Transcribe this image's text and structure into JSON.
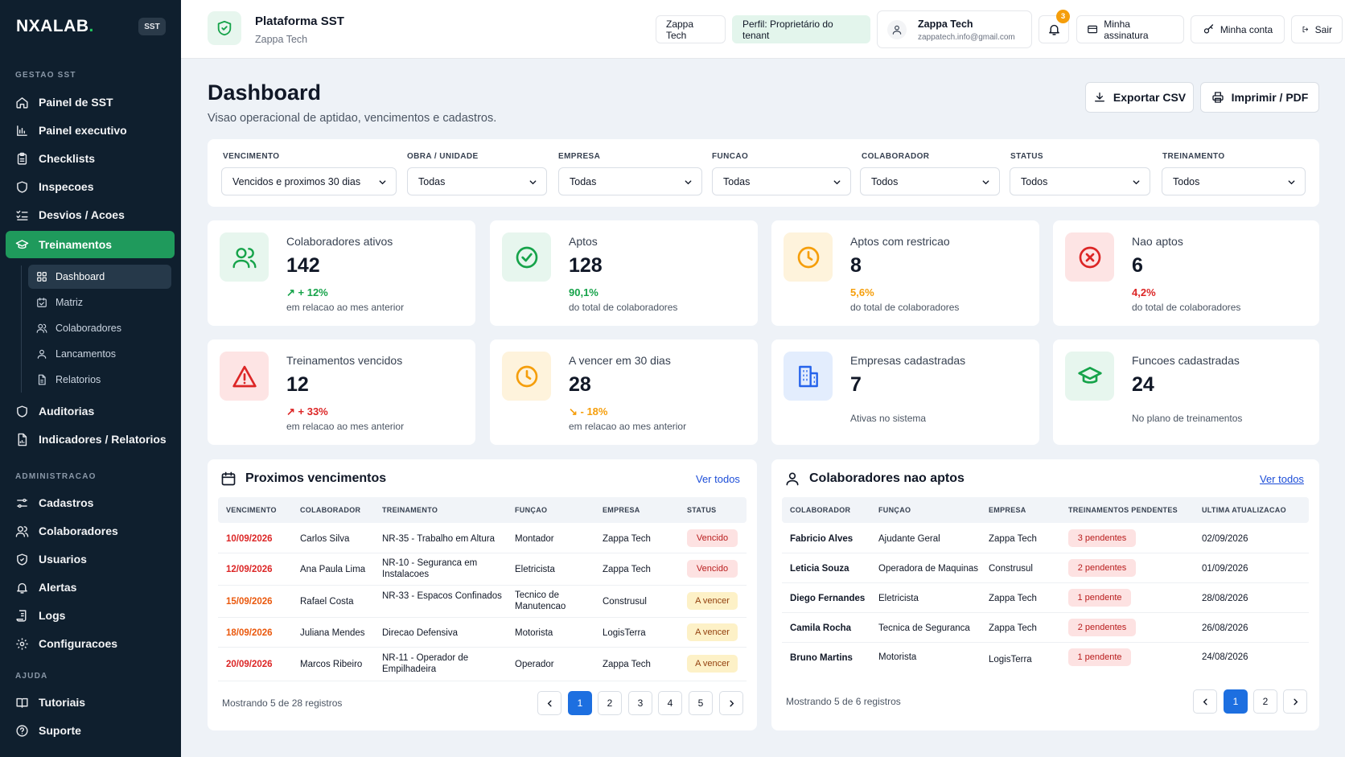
{
  "brand": {
    "name": "NXALAB",
    "dot": ".",
    "badge": "SST"
  },
  "sidebar": {
    "sections": [
      "GESTAO SST",
      "ADMINISTRACAO",
      "AJUDA"
    ],
    "gestao": [
      {
        "label": "Painel de SST",
        "icon": "home-icon"
      },
      {
        "label": "Painel executivo",
        "icon": "bar-chart-icon"
      },
      {
        "label": "Checklists",
        "icon": "clipboard-icon"
      },
      {
        "label": "Inspecoes",
        "icon": "shield-icon"
      },
      {
        "label": "Desvios / Acoes",
        "icon": "list-check-icon"
      },
      {
        "label": "Treinamentos",
        "icon": "graduation-cap-icon"
      }
    ],
    "treinamentos_sub": [
      {
        "label": "Dashboard",
        "icon": "grid-icon"
      },
      {
        "label": "Matriz",
        "icon": "calendar-check-icon"
      },
      {
        "label": "Colaboradores",
        "icon": "users-icon"
      },
      {
        "label": "Lancamentos",
        "icon": "user-icon"
      },
      {
        "label": "Relatorios",
        "icon": "file-icon"
      }
    ],
    "gestao_more": [
      {
        "label": "Auditorias",
        "icon": "shield-icon"
      },
      {
        "label": "Indicadores / Relatorios",
        "icon": "file-chart-icon"
      }
    ],
    "admin": [
      {
        "label": "Cadastros",
        "icon": "sliders-icon"
      },
      {
        "label": "Colaboradores",
        "icon": "users-icon"
      },
      {
        "label": "Usuarios",
        "icon": "shield-user-icon"
      },
      {
        "label": "Alertas",
        "icon": "bell-icon"
      },
      {
        "label": "Logs",
        "icon": "scroll-icon"
      },
      {
        "label": "Configuracoes",
        "icon": "gear-icon"
      }
    ],
    "ajuda": [
      {
        "label": "Tutoriais",
        "icon": "book-icon"
      },
      {
        "label": "Suporte",
        "icon": "help-icon"
      }
    ]
  },
  "topbar": {
    "title": "Plataforma SST",
    "subtitle": "Zappa Tech",
    "tenant_chip": "Zappa Tech",
    "profile_chip": "Perfil: Proprietário do tenant",
    "user_name": "Zappa Tech",
    "user_email": "zappatech.info@gmail.com",
    "notifications": "3",
    "subscription": "Minha assinatura",
    "account": "Minha conta",
    "logout": "Sair"
  },
  "header": {
    "title": "Dashboard",
    "subtitle": "Visao operacional de aptidao, vencimentos e cadastros.",
    "export_csv": "Exportar CSV",
    "print_pdf": "Imprimir / PDF"
  },
  "filters": [
    {
      "label": "VENCIMENTO",
      "value": "Vencidos e proximos 30 dias"
    },
    {
      "label": "OBRA / UNIDADE",
      "value": "Todas"
    },
    {
      "label": "EMPRESA",
      "value": "Todas"
    },
    {
      "label": "FUNCAO",
      "value": "Todas"
    },
    {
      "label": "COLABORADOR",
      "value": "Todos"
    },
    {
      "label": "STATUS",
      "value": "Todos"
    },
    {
      "label": "TREINAMENTO",
      "value": "Todos"
    }
  ],
  "cards": [
    {
      "title": "Colaboradores ativos",
      "value": "142",
      "trend": "+ 12%",
      "desc": "em relacao ao mes anterior",
      "icon": "users-icon",
      "color": "#16a34a"
    },
    {
      "title": "Aptos",
      "value": "128",
      "trend": "90,1%",
      "desc": "do total de colaboradores",
      "icon": "check-circle-icon",
      "color": "#16a34a"
    },
    {
      "title": "Aptos com restricao",
      "value": "8",
      "trend": "5,6%",
      "desc": "do total de colaboradores",
      "icon": "clock-icon",
      "color": "#f59e0b"
    },
    {
      "title": "Nao aptos",
      "value": "6",
      "trend": "4,2%",
      "desc": "do total de colaboradores",
      "icon": "x-circle-icon",
      "color": "#dc2626"
    },
    {
      "title": "Treinamentos vencidos",
      "value": "12",
      "trend": "+ 33%",
      "desc": "em relacao ao mes anterior",
      "icon": "warning-icon",
      "color": "#dc2626"
    },
    {
      "title": "A vencer em 30 dias",
      "value": "28",
      "trend": "- 18%",
      "desc": "em relacao ao mes anterior",
      "icon": "clock-icon",
      "color": "#f59e0b"
    },
    {
      "title": "Empresas cadastradas",
      "value": "7",
      "desc": "Ativas no sistema",
      "icon": "building-icon",
      "color": "#2563eb"
    },
    {
      "title": "Funcoes cadastradas",
      "value": "24",
      "desc": "No plano de treinamentos",
      "icon": "graduation-cap-icon",
      "color": "#16a34a"
    }
  ],
  "vencimentos": {
    "title": "Proximos vencimentos",
    "link": "Ver todos",
    "headers": [
      "VENCIMENTO",
      "COLABORADOR",
      "TREINAMENTO",
      "FUNÇAO",
      "EMPRESA",
      "STATUS"
    ],
    "rows": [
      {
        "date": "10/09/2026",
        "colaborador": "Carlos Silva",
        "treinamento": "NR-35 - Trabalho em Altura",
        "funcao": "Montador",
        "empresa": "Zappa Tech",
        "status": "Vencido"
      },
      {
        "date": "12/09/2026",
        "colaborador": "Ana Paula Lima",
        "treinamento": "NR-10 - Seguranca em Instalacoes",
        "funcao": "Eletricista",
        "empresa": "Zappa Tech",
        "status": "Vencido"
      },
      {
        "date": "15/09/2026",
        "colaborador": "Rafael Costa",
        "treinamento": "NR-33 - Espacos Confinados",
        "funcao": "Tecnico de Manutencao",
        "empresa": "Construsul",
        "status": "A vencer"
      },
      {
        "date": "18/09/2026",
        "colaborador": "Juliana Mendes",
        "treinamento": "Direcao Defensiva",
        "funcao": "Motorista",
        "empresa": "LogisTerra",
        "status": "A vencer"
      },
      {
        "date": "20/09/2026",
        "colaborador": "Marcos Ribeiro",
        "treinamento": "NR-11 - Operador de Empilhadeira",
        "funcao": "Operador",
        "empresa": "Zappa Tech",
        "status": "A vencer"
      }
    ],
    "footer": "Mostrando 5 de 28 registros",
    "pages": [
      "1",
      "2",
      "3",
      "4",
      "5"
    ],
    "status_colors": {
      "Vencido": "#dc2626",
      "A vencer": "#ea580c"
    }
  },
  "nao_aptos": {
    "title": "Colaboradores nao aptos",
    "link": "Ver todos",
    "headers": [
      "COLABORADOR",
      "FUNÇAO",
      "EMPRESA",
      "TREINAMENTOS PENDENTES",
      "ULTIMA ATUALIZACAO"
    ],
    "rows": [
      {
        "colaborador": "Fabricio Alves",
        "funcao": "Ajudante Geral",
        "empresa": "Zappa Tech",
        "pendentes": "3 pendentes",
        "data": "02/09/2026"
      },
      {
        "colaborador": "Leticia Souza",
        "funcao": "Operadora de Maquinas",
        "empresa": "Construsul",
        "pendentes": "2 pendentes",
        "data": "01/09/2026"
      },
      {
        "colaborador": "Diego Fernandes",
        "funcao": "Eletricista",
        "empresa": "Zappa Tech",
        "pendentes": "1 pendente",
        "data": "28/08/2026"
      },
      {
        "colaborador": "Camila Rocha",
        "funcao": "Tecnica de Seguranca",
        "empresa": "Zappa Tech",
        "pendentes": "2 pendentes",
        "data": "26/08/2026"
      },
      {
        "colaborador": "Bruno Martins",
        "funcao": "Motorista",
        "empresa": "LogisTerra",
        "pendentes": "1 pendente",
        "data": "24/08/2026"
      }
    ],
    "footer": "Mostrando 5 de 6 registros",
    "pages": [
      "1",
      "2"
    ]
  }
}
